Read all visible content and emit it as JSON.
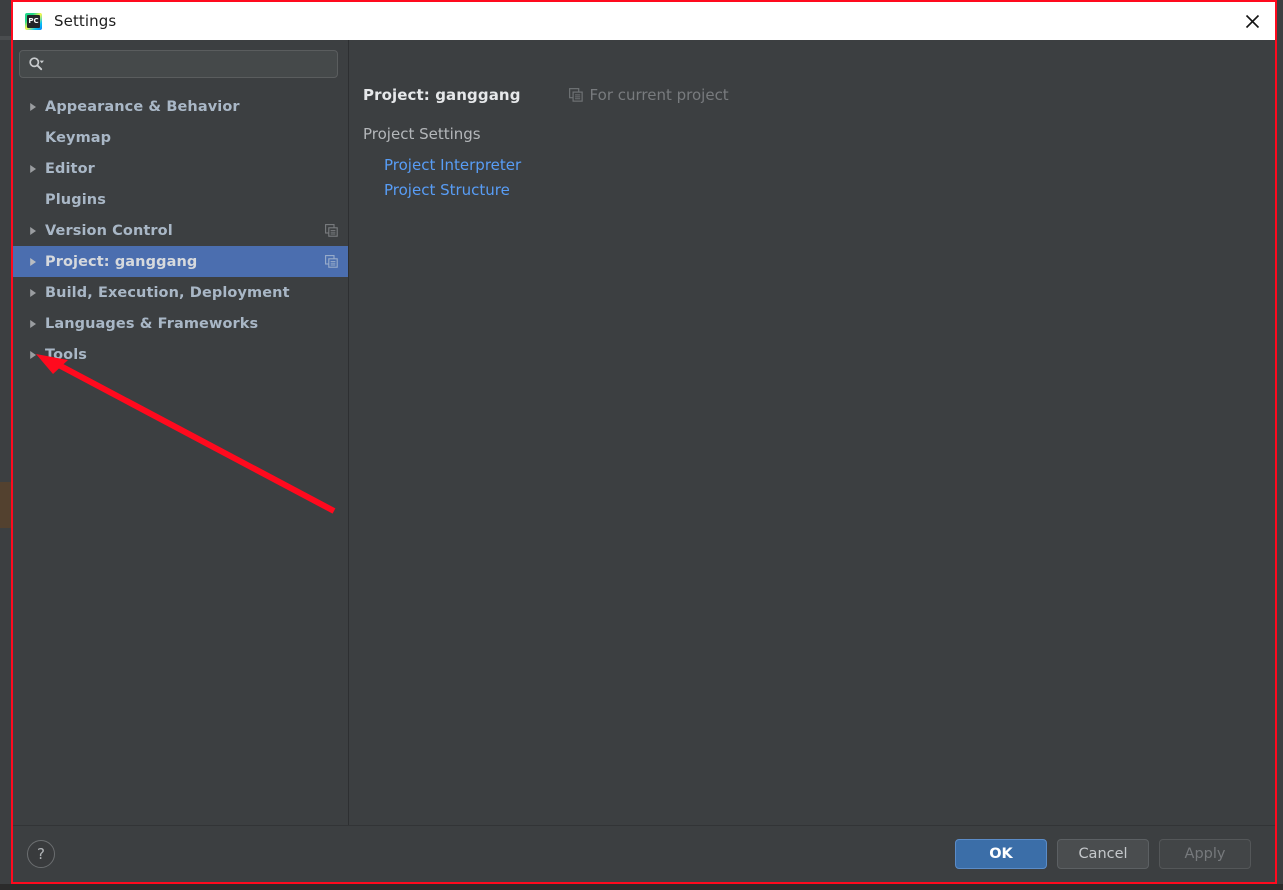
{
  "window": {
    "title": "Settings",
    "app_icon": "pycharm-icon",
    "app_icon_text": "PC",
    "close_icon": "close-icon"
  },
  "sidebar": {
    "search": {
      "value": "",
      "placeholder": "",
      "icon": "search-icon",
      "dropdown_icon": "chevron-down-icon"
    },
    "items": [
      {
        "label": "Appearance & Behavior",
        "expandable": true,
        "selected": false,
        "badge": false
      },
      {
        "label": "Keymap",
        "expandable": false,
        "selected": false,
        "badge": false
      },
      {
        "label": "Editor",
        "expandable": true,
        "selected": false,
        "badge": false
      },
      {
        "label": "Plugins",
        "expandable": false,
        "selected": false,
        "badge": false
      },
      {
        "label": "Version Control",
        "expandable": true,
        "selected": false,
        "badge": true
      },
      {
        "label": "Project: ganggang",
        "expandable": true,
        "selected": true,
        "badge": true
      },
      {
        "label": "Build, Execution, Deployment",
        "expandable": true,
        "selected": false,
        "badge": false
      },
      {
        "label": "Languages & Frameworks",
        "expandable": true,
        "selected": false,
        "badge": false
      },
      {
        "label": "Tools",
        "expandable": true,
        "selected": false,
        "badge": false
      }
    ]
  },
  "content": {
    "title": "Project: ganggang",
    "scope_label": "For current project",
    "scope_icon": "copy-icon",
    "section_label": "Project Settings",
    "links": [
      {
        "label": "Project Interpreter"
      },
      {
        "label": "Project Structure"
      }
    ]
  },
  "footer": {
    "help_label": "?",
    "ok_label": "OK",
    "cancel_label": "Cancel",
    "apply_label": "Apply"
  },
  "colors": {
    "window_bg": "#3c3f41",
    "titlebar_bg": "#ffffff",
    "selection_blue": "#4b6eaf",
    "link_blue": "#589df6",
    "text": "#a9b7c6",
    "primary_button": "#3b6ea8",
    "annotation_red": "#ff0a1e"
  },
  "annotation": {
    "arrow_color": "#ff0a1e",
    "frame_color": "#ff0a1e"
  }
}
